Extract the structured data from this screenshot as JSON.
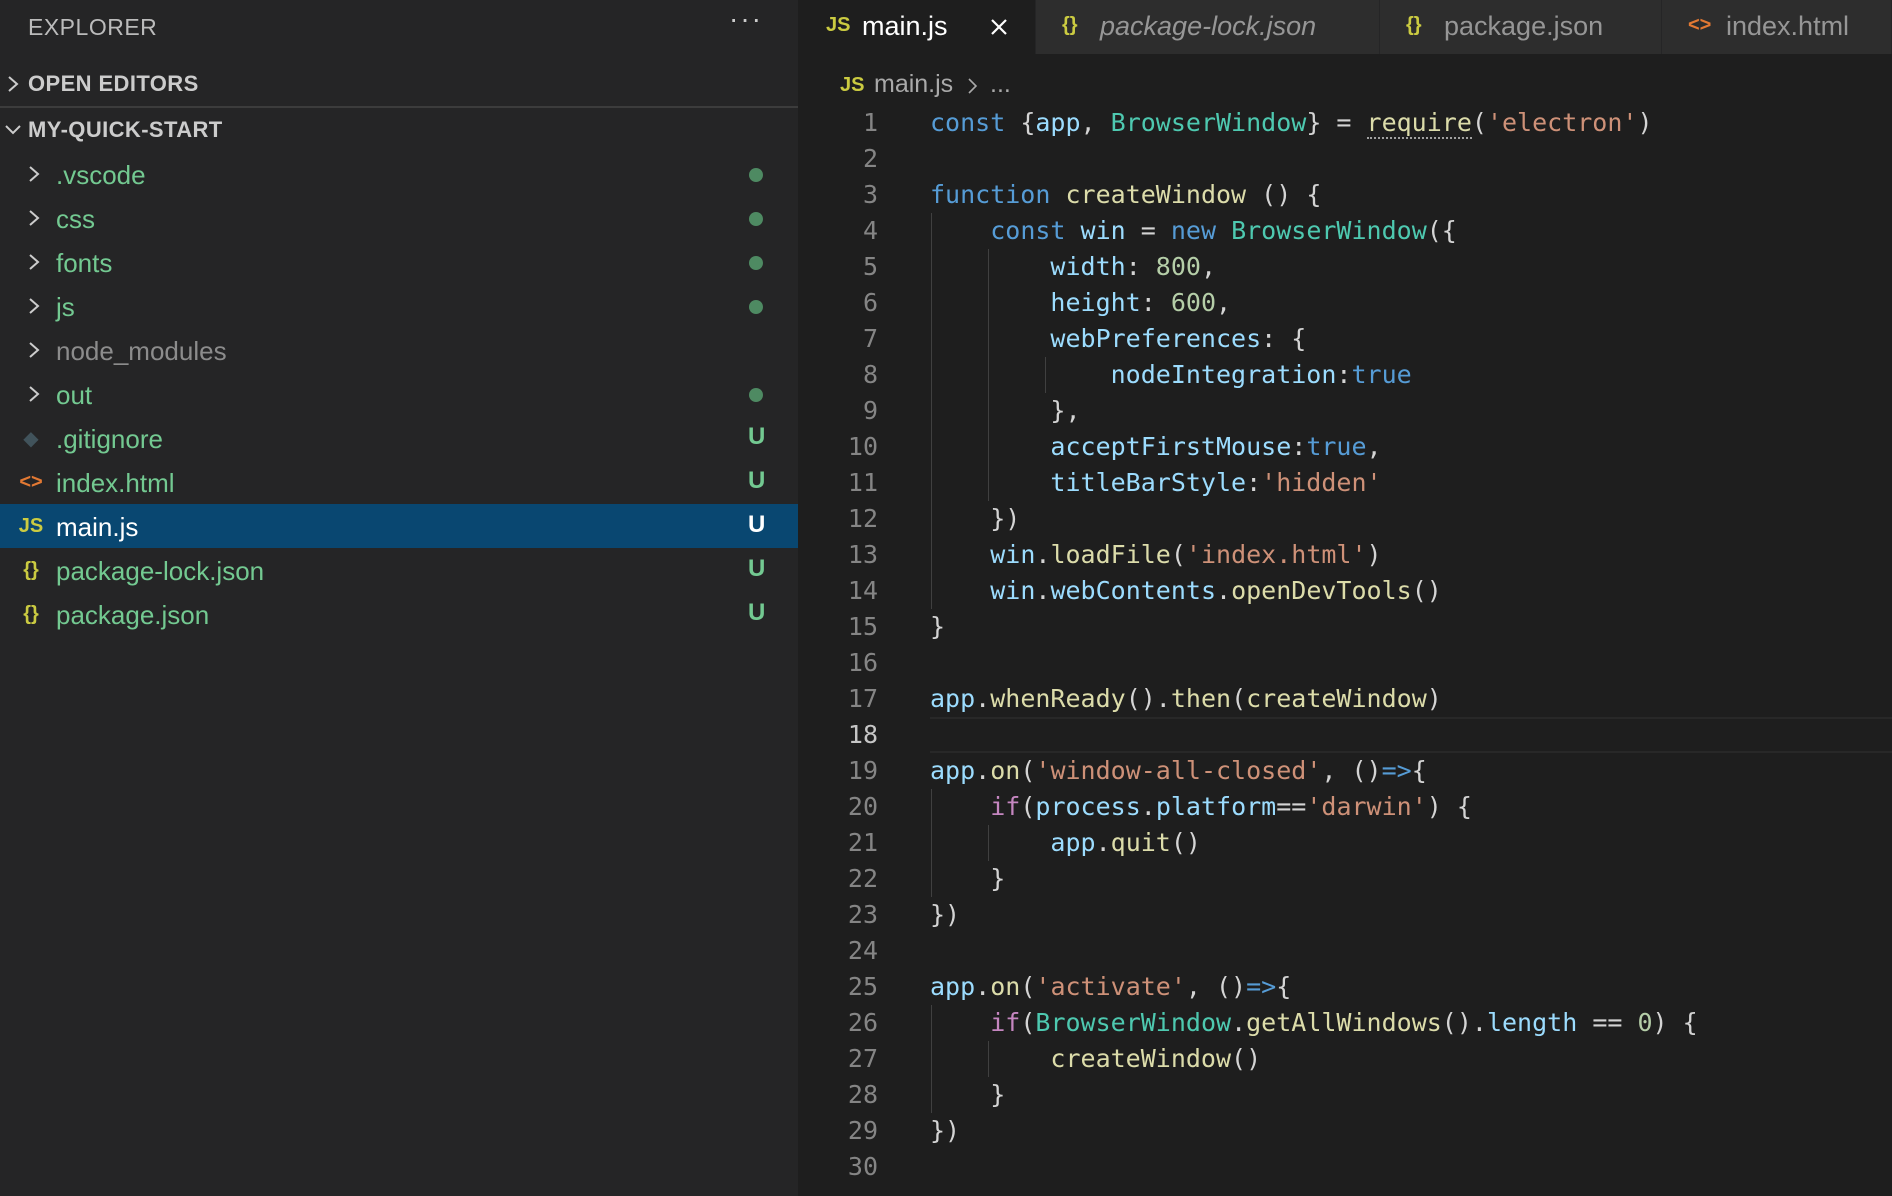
{
  "sidebar": {
    "header": "EXPLORER",
    "more_actions": "···",
    "open_editors_label": "OPEN EDITORS",
    "project_label": "MY-QUICK-START",
    "items": [
      {
        "name": ".vscode",
        "kind": "folder",
        "status": "dot",
        "color": "#73c991"
      },
      {
        "name": "css",
        "kind": "folder",
        "status": "dot",
        "color": "#73c991"
      },
      {
        "name": "fonts",
        "kind": "folder",
        "status": "dot",
        "color": "#73c991"
      },
      {
        "name": "js",
        "kind": "folder",
        "status": "dot",
        "color": "#73c991"
      },
      {
        "name": "node_modules",
        "kind": "folder",
        "status": "",
        "color": "#8c8c8c"
      },
      {
        "name": "out",
        "kind": "folder",
        "status": "dot",
        "color": "#73c991"
      },
      {
        "name": ".gitignore",
        "kind": "file",
        "icon": "git-icon",
        "icon_glyph": "◆",
        "icon_color": "#41535b",
        "status": "U",
        "color": "#73c991"
      },
      {
        "name": "index.html",
        "kind": "file",
        "icon": "html-icon",
        "icon_glyph": "<>",
        "icon_color": "#e37933",
        "status": "U",
        "color": "#73c991"
      },
      {
        "name": "main.js",
        "kind": "file",
        "icon": "js-icon",
        "icon_glyph": "JS",
        "icon_color": "#cbcb41",
        "status": "U",
        "color": "#ffffff",
        "selected": true
      },
      {
        "name": "package-lock.json",
        "kind": "file",
        "icon": "json-icon",
        "icon_glyph": "{}",
        "icon_color": "#cbcb41",
        "status": "U",
        "color": "#73c991"
      },
      {
        "name": "package.json",
        "kind": "file",
        "icon": "json-icon",
        "icon_glyph": "{}",
        "icon_color": "#cbcb41",
        "status": "U",
        "color": "#73c991"
      }
    ]
  },
  "tabs": [
    {
      "label": "main.js",
      "icon": "js-icon",
      "icon_glyph": "JS",
      "icon_color": "#cbcb41",
      "active": true,
      "italic": false
    },
    {
      "label": "package-lock.json",
      "icon": "json-icon",
      "icon_glyph": "{}",
      "icon_color": "#cbcb41",
      "active": false,
      "italic": true
    },
    {
      "label": "package.json",
      "icon": "json-icon",
      "icon_glyph": "{}",
      "icon_color": "#cbcb41",
      "active": false,
      "italic": false
    },
    {
      "label": "index.html",
      "icon": "html-icon",
      "icon_glyph": "<>",
      "icon_color": "#e37933",
      "active": false,
      "italic": false
    }
  ],
  "breadcrumb": {
    "icon_glyph": "JS",
    "file": "main.js",
    "more": "..."
  },
  "editor": {
    "current_line": 18,
    "lines": [
      "const {app, BrowserWindow} = require('electron')",
      "",
      "function createWindow () {",
      "    const win = new BrowserWindow({",
      "        width: 800,",
      "        height: 600,",
      "        webPreferences: {",
      "            nodeIntegration:true",
      "        },",
      "        acceptFirstMouse:true,",
      "        titleBarStyle:'hidden'",
      "    })",
      "    win.loadFile('index.html')",
      "    win.webContents.openDevTools()",
      "}",
      "",
      "app.whenReady().then(createWindow)",
      "",
      "app.on('window-all-closed', ()=>{",
      "    if(process.platform=='darwin') {",
      "        app.quit()",
      "    }",
      "})",
      "",
      "app.on('activate', ()=>{",
      "    if(BrowserWindow.getAllWindows().length == 0) {",
      "        createWindow()",
      "    }",
      "})",
      ""
    ]
  }
}
